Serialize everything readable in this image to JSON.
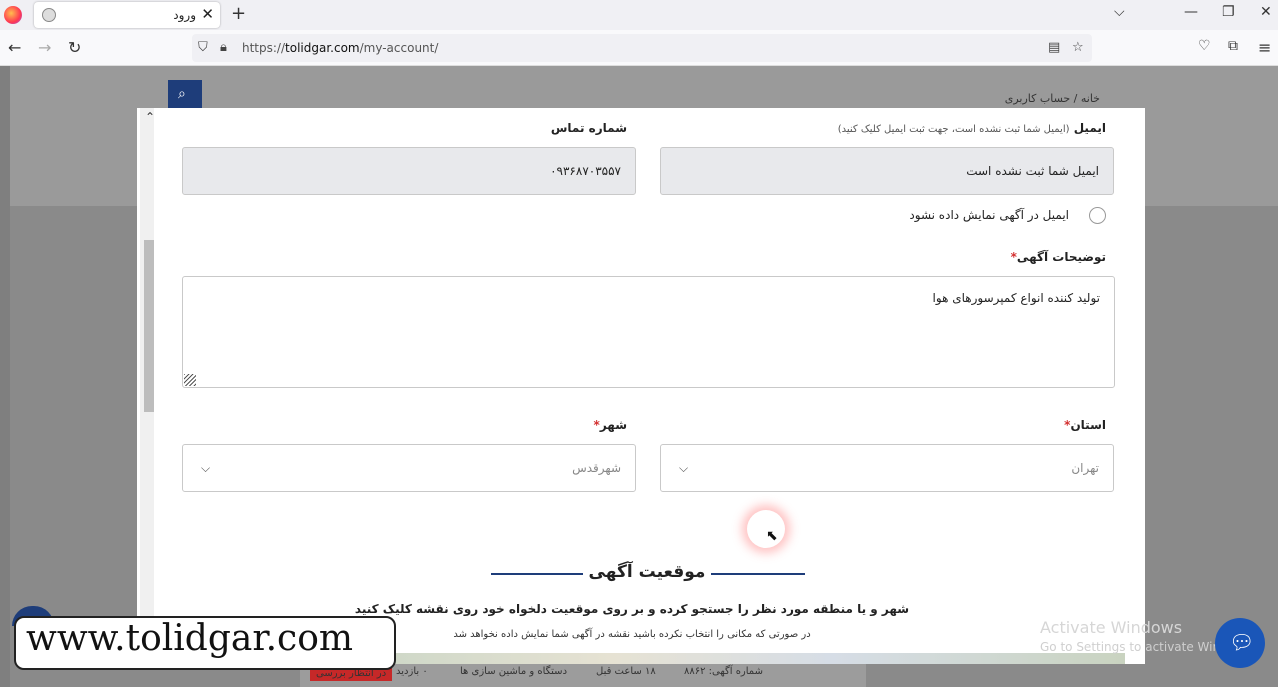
{
  "browser": {
    "tab_title": "ورود",
    "tab_close": "✕",
    "new_tab": "+",
    "url_prefix": "https://",
    "url_domain": "tolidgar.com",
    "url_path": "/my-account/"
  },
  "background": {
    "breadcrumb": "خانه / حساب کاربری",
    "status_pending": "در انتظار بررسی",
    "ad_number": "شماره آگهی: ۸۸۶۲",
    "time_ago": "۱۸ ساعت قبل",
    "category": "دستگاه و ماشین سازی ها",
    "visits": "۰ بازدید"
  },
  "form": {
    "email_label": "ایمیل",
    "email_hint": "(ایمیل شما ثبت نشده است، جهت ثبت ایمیل کلیک کنید)",
    "email_value": "ایمیل شما ثبت نشده است",
    "phone_label": "شماره تماس",
    "phone_value": "۰۹۳۶۸۷۰۳۵۵۷",
    "hide_email_label": "ایمیل در آگهی نمایش داده نشود",
    "description_label": "توضیحات آگهی",
    "description_value": "تولید کننده انواع کمپرسورهای هوا",
    "province_label": "استان",
    "province_value": "تهران",
    "city_label": "شهر",
    "city_value": "شهرقدس",
    "required_mark": "*"
  },
  "location": {
    "title": "موقعیت آگهی",
    "instruction": "شهر و یا منطقه مورد نظر را جستجو کرده و بر روی موقعیت دلخواه خود روی نقشه کلیک کنید",
    "note": "در صورتی که مکانی را انتخاب نکرده باشید نقشه در آگهی شما نمایش داده نخواهد شد"
  },
  "overlay": {
    "watermark": "www.tolidgar.com",
    "activate_title": "Activate Windows",
    "activate_sub": "Go to Settings to activate Windows."
  },
  "colors": {
    "brand_blue": "#1e3d7a",
    "required_red": "#d32f2f",
    "chat_blue": "#1a56b8"
  }
}
